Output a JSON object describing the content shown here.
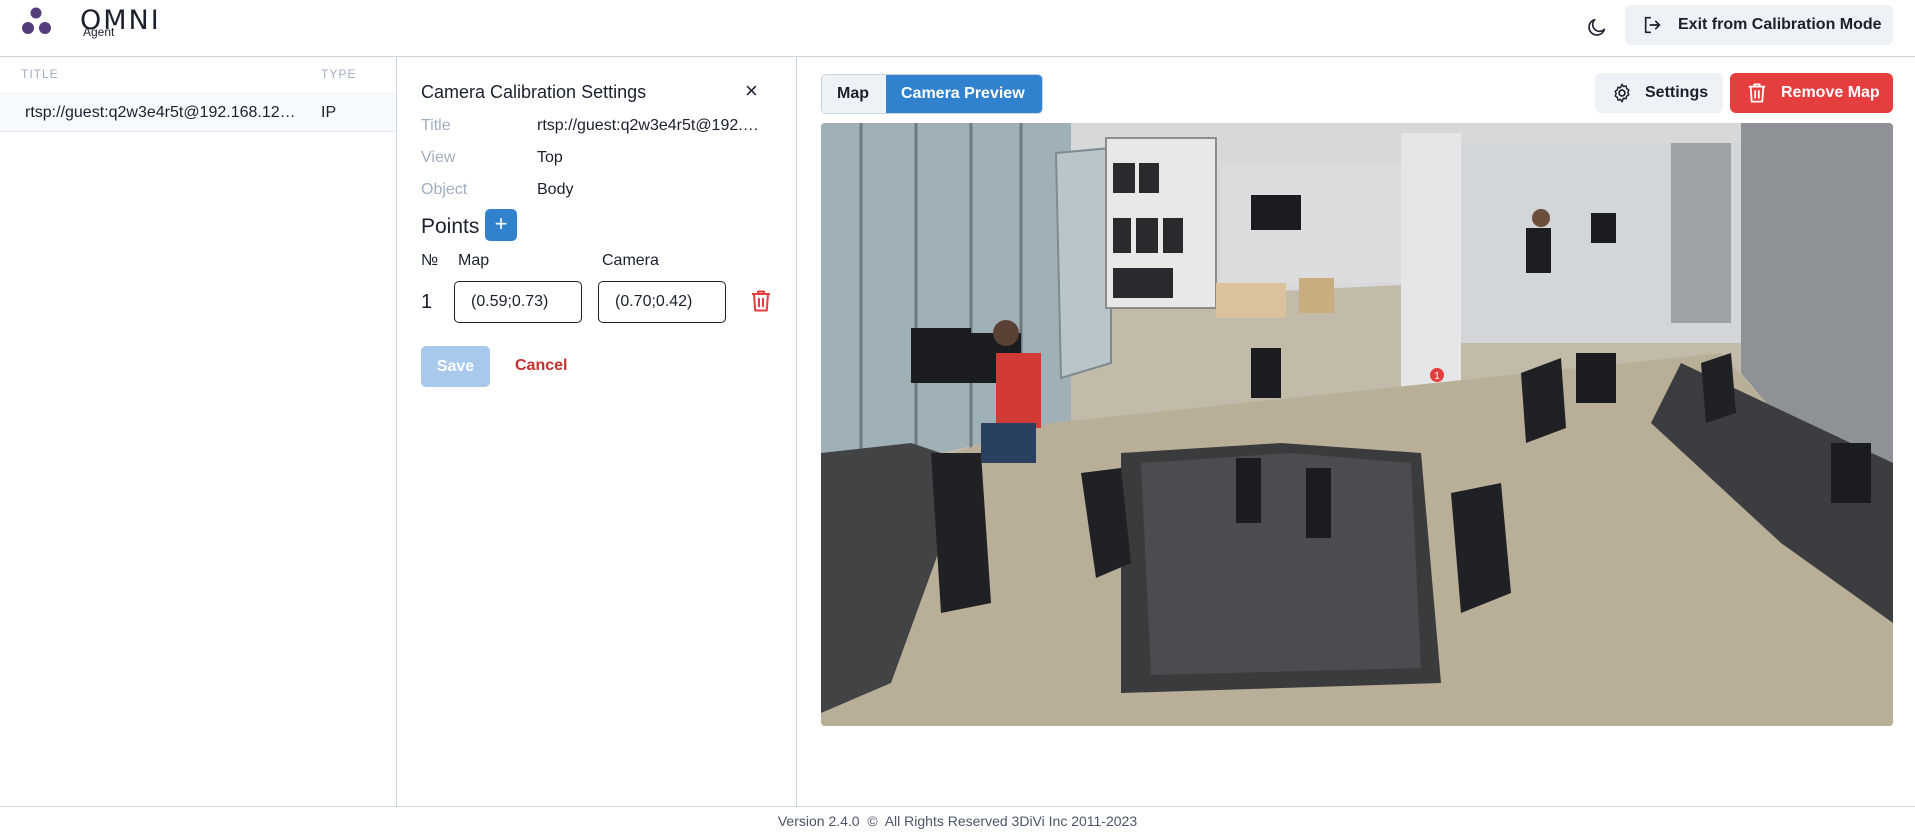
{
  "header": {
    "logo_text": "OMNI",
    "logo_sub": "Agent",
    "theme_icon": "moon-icon",
    "exit_label": "Exit from Calibration Mode"
  },
  "camera_list": {
    "col_title": "TITLE",
    "col_type": "TYPE",
    "items": [
      {
        "title": "rtsp://guest:q2w3e4r5t@192.168.12…",
        "type": "IP"
      }
    ]
  },
  "calibration": {
    "title": "Camera Calibration Settings",
    "fields": [
      {
        "label": "Title",
        "value": "rtsp://guest:q2w3e4r5t@192.1…"
      },
      {
        "label": "View",
        "value": "Top"
      },
      {
        "label": "Object",
        "value": "Body"
      }
    ],
    "points_title": "Points",
    "add_label": "+",
    "col_no": "№",
    "col_map": "Map",
    "col_camera": "Camera",
    "points": [
      {
        "no": "1",
        "map": "(0.59;0.73)",
        "camera": "(0.70;0.42)"
      }
    ],
    "save_label": "Save",
    "cancel_label": "Cancel"
  },
  "preview": {
    "tabs": [
      "Map",
      "Camera Preview"
    ],
    "active_tab": "Camera Preview",
    "settings_label": "Settings",
    "remove_label": "Remove Map",
    "marker_label": "1"
  },
  "footer": {
    "version": "Version 2.4.0",
    "copyright": "All Rights Reserved 3DiVi Inc 2011-2023"
  },
  "colors": {
    "primary": "#3182ce",
    "danger": "#e53e3e",
    "muted": "#a0aec0"
  }
}
